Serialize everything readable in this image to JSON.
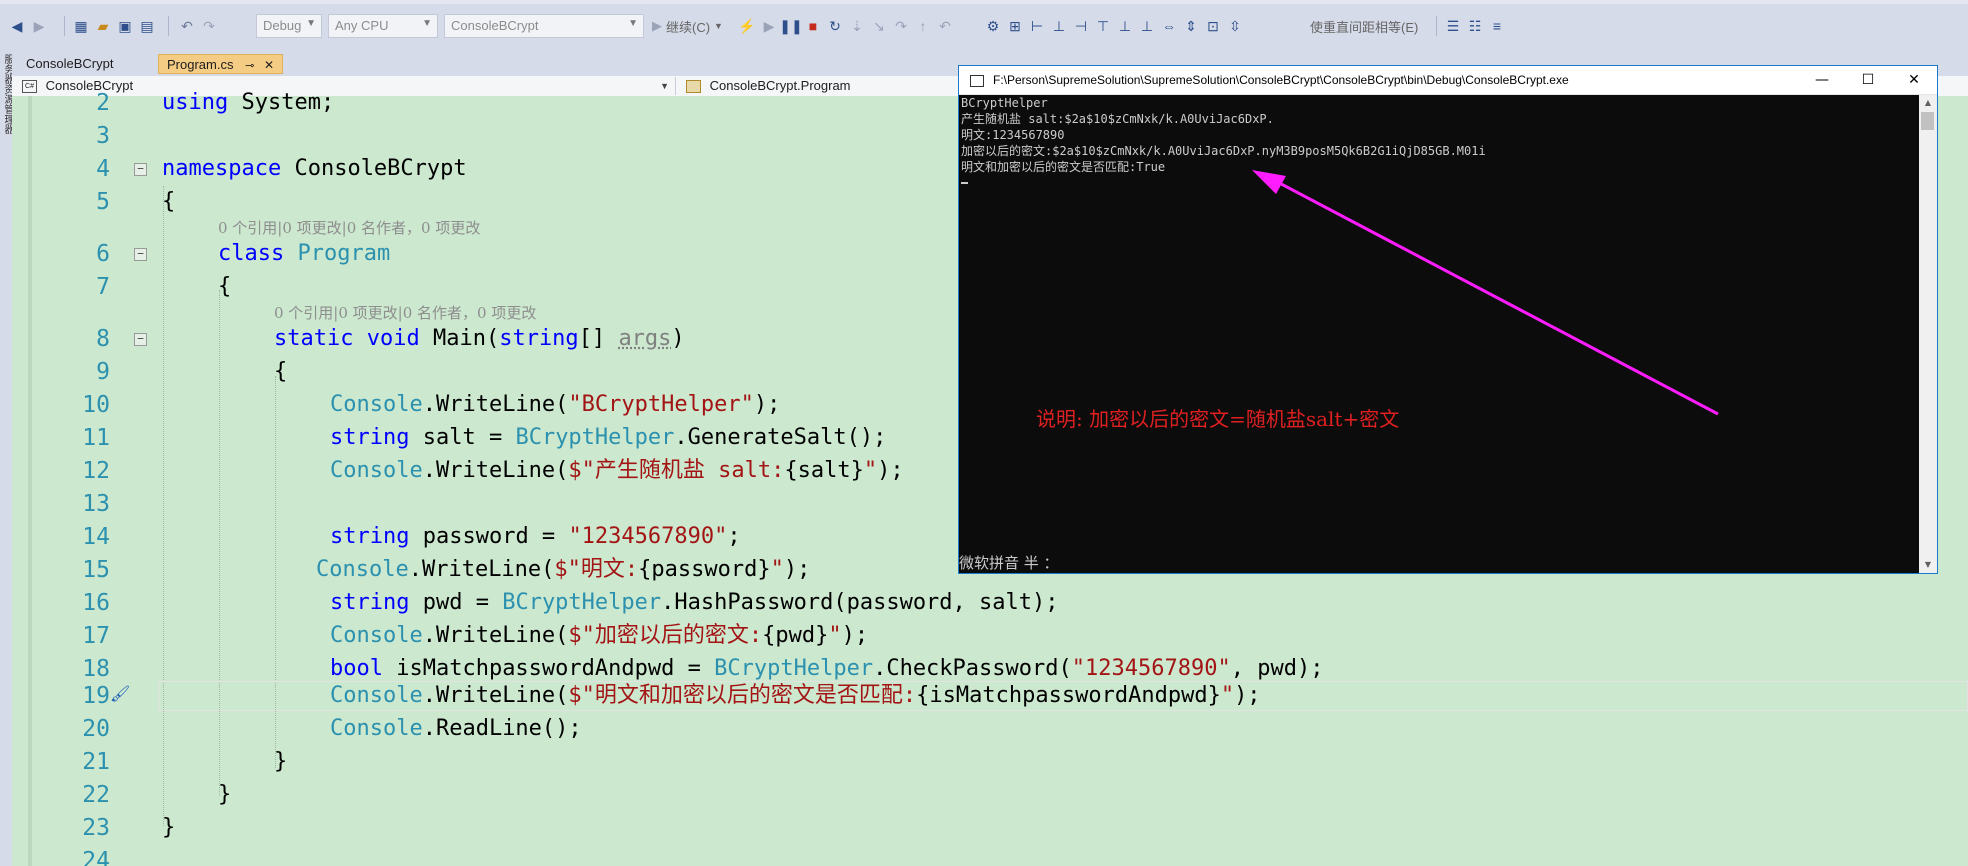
{
  "toolbar": {
    "config_value": "Debug",
    "platform_value": "Any CPU",
    "startup_project_value": "ConsoleBCrypt",
    "continue_label": "继续(C)",
    "find_label": "使重直间距相等(E)"
  },
  "side_strip": {
    "label": "服务器资源管理器"
  },
  "tabs": [
    {
      "label": "ConsoleBCrypt"
    },
    {
      "label": "Program.cs",
      "pin": "⊸",
      "close": "✕"
    }
  ],
  "nav": {
    "project": "ConsoleBCrypt",
    "project_icon": "C#",
    "class": "ConsoleBCrypt.Program"
  },
  "editor": {
    "lines": [
      {
        "num": "2"
      },
      {
        "num": "3"
      },
      {
        "num": "4"
      },
      {
        "num": "5"
      },
      {
        "num": "6"
      },
      {
        "num": "7"
      },
      {
        "num": "8"
      },
      {
        "num": "9"
      },
      {
        "num": "10"
      },
      {
        "num": "11"
      },
      {
        "num": "12"
      },
      {
        "num": "13"
      },
      {
        "num": "14"
      },
      {
        "num": "15"
      },
      {
        "num": "16"
      },
      {
        "num": "17"
      },
      {
        "num": "18"
      },
      {
        "num": "19"
      },
      {
        "num": "20"
      },
      {
        "num": "21"
      },
      {
        "num": "22"
      },
      {
        "num": "23"
      },
      {
        "num": "24"
      }
    ],
    "codelens_class": "0 个引用|0 项更改|0 名作者，0 项更改",
    "codelens_main": "0 个引用|0 项更改|0 名作者，0 项更改",
    "tokens": {
      "using": "using",
      "system": " System;",
      "namespace": "namespace",
      "ns_name": " ConsoleBCrypt",
      "open_brace": "{",
      "close_brace": "}",
      "class": "class",
      "class_name": " Program",
      "static": "static",
      "void": " void",
      "main": " Main(",
      "string_kw": "string",
      "args_arr": "[] ",
      "args": "args",
      "rparen": ")",
      "console": "Console",
      "writeline_open": ".WriteLine(",
      "close_stmt": ");",
      "s_bcrypthelper": "\"BCryptHelper\"",
      "string": "string",
      "salt_assign": " salt = ",
      "bcrypthelper": "BCryptHelper",
      "gensalt": ".GenerateSalt();",
      "s_salt_pre": "$\"产生随机盐 salt:",
      "salt_interp": "{salt}",
      "s_end": "\"",
      "password_assign": " password = ",
      "s_password": "\"1234567890\"",
      "semicolon": ";",
      "s_mingwen": "$\"明文:",
      "password_interp": "{password}",
      "pwd_assign": " pwd = ",
      "hashpassword": ".HashPassword(password, salt);",
      "s_miwen": "$\"加密以后的密文:",
      "pwd_interp": "{pwd}",
      "bool": "bool",
      "ismatch_assign": " isMatchpasswordAndpwd = ",
      "checkpassword_open": ".CheckPassword(",
      "pwd_close": ", pwd);",
      "s_match": "$\"明文和加密以后的密文是否匹配:",
      "ismatch_interp": "{isMatchpasswordAndpwd}",
      "readline": ".ReadLine();"
    }
  },
  "console": {
    "title": "F:\\Person\\SupremeSolution\\SupremeSolution\\ConsoleBCrypt\\ConsoleBCrypt\\bin\\Debug\\ConsoleBCrypt.exe",
    "minimize": "—",
    "maximize": "☐",
    "close": "✕",
    "lines": [
      "BCryptHelper",
      "产生随机盐 salt:$2a$10$zCmNxk/k.A0UviJac6DxP.",
      "明文:1234567890",
      "加密以后的密文:$2a$10$zCmNxk/k.A0UviJac6DxP.nyM3B9posM5Qk6B2G1iQjD85GB.M01i",
      "明文和加密以后的密文是否匹配:True"
    ],
    "ime_status": "微软拼音 半 ："
  },
  "annotation": {
    "text": "说明: 加密以后的密文=随机盐salt+密文",
    "arrow_color": "#ff1dff"
  }
}
